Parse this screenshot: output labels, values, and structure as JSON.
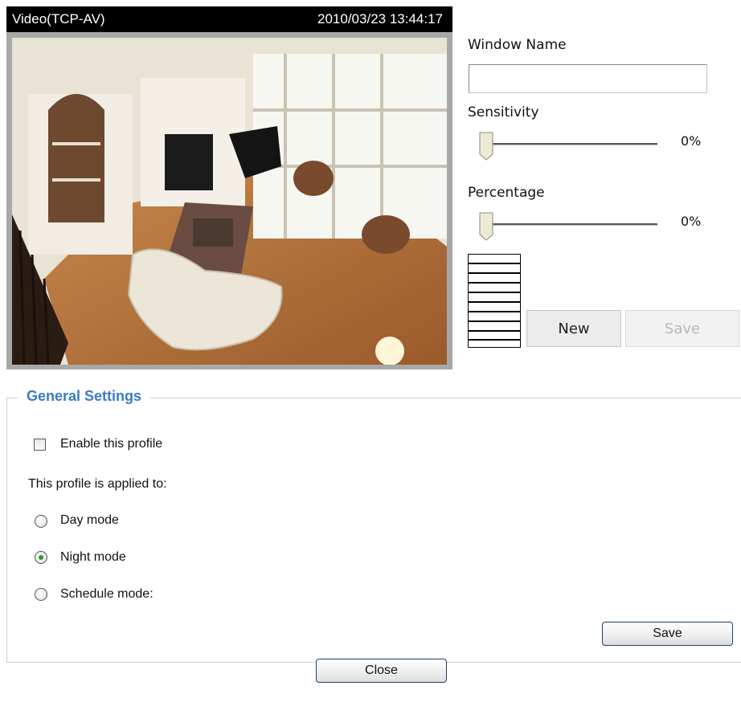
{
  "video": {
    "title": "Video(TCP-AV)",
    "timestamp": "2010/03/23 13:44:17"
  },
  "motion_window": {
    "window_name_label": "Window Name",
    "window_name_value": "",
    "sensitivity_label": "Sensitivity",
    "sensitivity_value": "0%",
    "percentage_label": "Percentage",
    "percentage_value": "0%",
    "new_label": "New",
    "save_label": "Save"
  },
  "general_settings": {
    "legend": "General Settings",
    "enable_label": "Enable this profile",
    "enable_checked": false,
    "applied_to_label": "This profile is applied to:",
    "modes": [
      {
        "label": "Day mode",
        "selected": false
      },
      {
        "label": "Night mode",
        "selected": true
      },
      {
        "label": "Schedule mode:",
        "selected": false
      }
    ],
    "save_label": "Save"
  },
  "footer": {
    "close_label": "Close"
  },
  "colors": {
    "legend_blue": "#3a7cc4",
    "radio_selected": "#2a9a2a"
  }
}
